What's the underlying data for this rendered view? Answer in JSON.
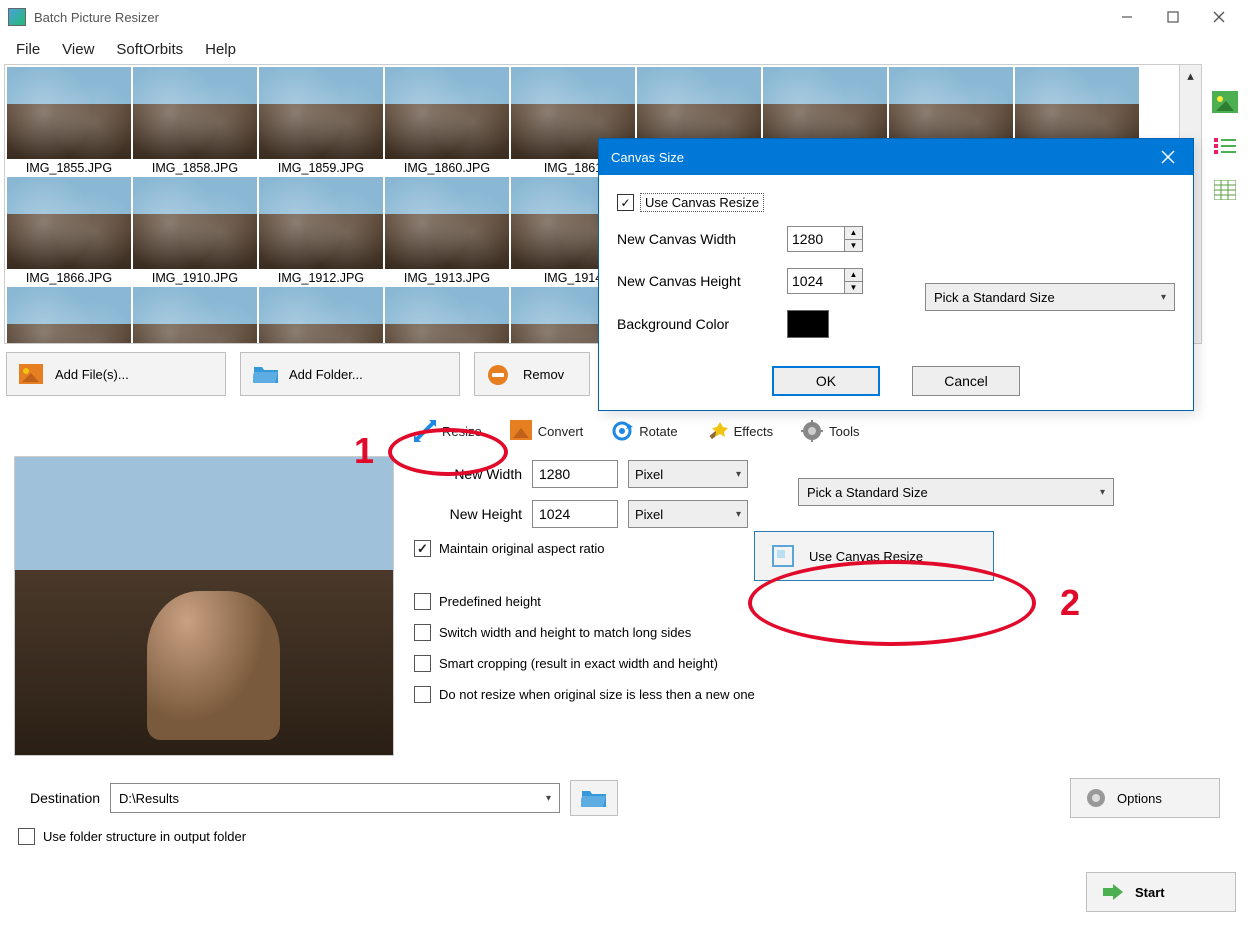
{
  "window": {
    "title": "Batch Picture Resizer"
  },
  "menu": {
    "file": "File",
    "view": "View",
    "softorbits": "SoftOrbits",
    "help": "Help"
  },
  "thumbnails": [
    "IMG_1855.JPG",
    "IMG_1858.JPG",
    "IMG_1859.JPG",
    "IMG_1860.JPG",
    "IMG_1861",
    "",
    "",
    "",
    "",
    "IMG_1866.JPG",
    "IMG_1910.JPG",
    "IMG_1912.JPG",
    "IMG_1913.JPG",
    "IMG_1914",
    "",
    "",
    "",
    ""
  ],
  "actions": {
    "add_files": "Add File(s)...",
    "add_folder": "Add Folder...",
    "remove": "Remov"
  },
  "tabs": {
    "resize": "Resize",
    "convert": "Convert",
    "rotate": "Rotate",
    "effects": "Effects",
    "tools": "Tools"
  },
  "resize": {
    "new_width_label": "New Width",
    "new_width": "1280",
    "new_height_label": "New Height",
    "new_height": "1024",
    "unit": "Pixel",
    "std_size": "Pick a Standard Size",
    "maintain": "Maintain original aspect ratio",
    "predefined": "Predefined height",
    "switch": "Switch width and height to match long sides",
    "smart": "Smart cropping (result in exact width and height)",
    "no_resize": "Do not resize when original size is less then a new one",
    "canvas_btn": "Use Canvas Resize"
  },
  "dialog": {
    "title": "Canvas Size",
    "use_canvas": "Use Canvas Resize",
    "width_label": "New Canvas Width",
    "width": "1280",
    "height_label": "New Canvas Height",
    "height": "1024",
    "bg_label": "Background Color",
    "std_size": "Pick a Standard Size",
    "ok": "OK",
    "cancel": "Cancel"
  },
  "footer": {
    "dest_label": "Destination",
    "dest_value": "D:\\Results",
    "use_folder": "Use folder structure in output folder",
    "options": "Options",
    "start": "Start"
  },
  "annotations": {
    "one": "1",
    "two": "2"
  }
}
